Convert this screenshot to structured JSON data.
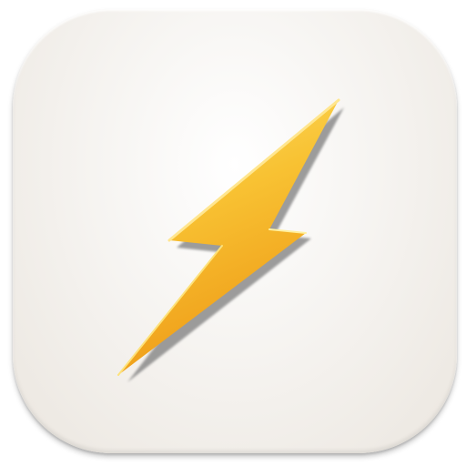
{
  "app_icon": {
    "icon": "lightning-bolt-icon",
    "colors": {
      "background_light": "#ffffff",
      "background_edge": "#ebe6df",
      "bolt_top": "#fcd34a",
      "bolt_bottom": "#f0a11a",
      "bolt_highlight": "#fff3a8",
      "bolt_shadow": "#8a8a8a"
    }
  }
}
